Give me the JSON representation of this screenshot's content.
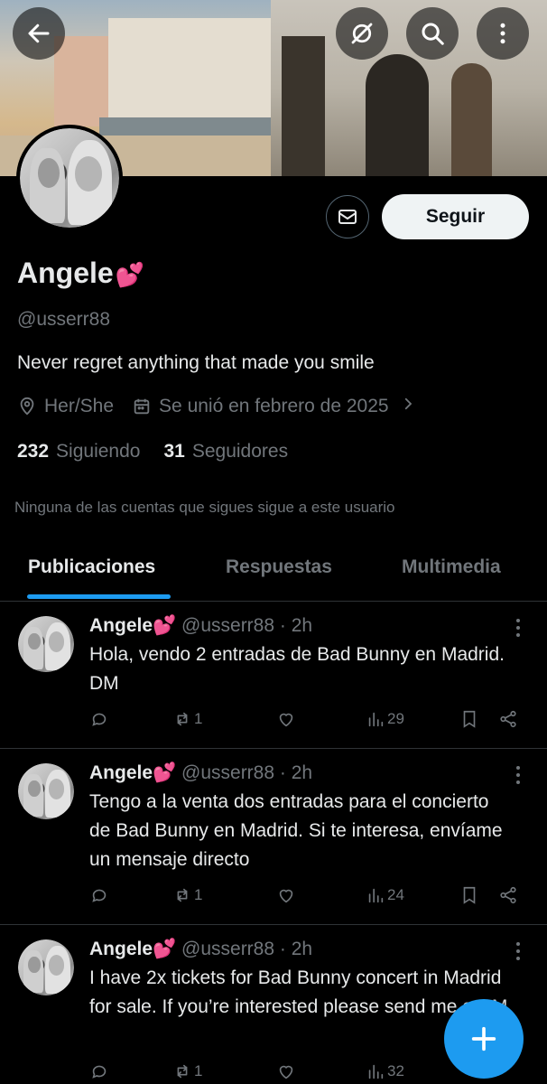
{
  "profile": {
    "name": "Angele",
    "name_emoji": "💕",
    "handle": "@usserr88",
    "bio": "Never regret anything that made you smile",
    "pronouns": "Her/She",
    "joined": "Se unió en febrero de 2025",
    "following_count": "232",
    "following_label": "Siguiendo",
    "followers_count": "31",
    "followers_label": "Seguidores",
    "mutuals_note": "Ninguna de las cuentas que sigues sigue a este usuario"
  },
  "actions": {
    "follow_label": "Seguir"
  },
  "tabs": [
    {
      "label": "Publicaciones",
      "active": true
    },
    {
      "label": "Respuestas",
      "active": false
    },
    {
      "label": "Multimedia",
      "active": false
    }
  ],
  "posts": [
    {
      "name": "Angele",
      "emoji": "💕",
      "handle": "@usserr88",
      "time": "· 2h",
      "text": "Hola, vendo 2 entradas de Bad Bunny en Madrid. DM",
      "reposts": "1",
      "views": "29"
    },
    {
      "name": "Angele",
      "emoji": "💕",
      "handle": "@usserr88",
      "time": "· 2h",
      "text": "Tengo a la venta dos entradas para el concierto de Bad Bunny en Madrid. Si te interesa, envíame un mensaje directo",
      "reposts": "1",
      "views": "24"
    },
    {
      "name": "Angele",
      "emoji": "💕",
      "handle": "@usserr88",
      "time": "· 2h",
      "text": "I have 2x tickets for Bad Bunny concert in Madrid for sale. If you’re interested please send me a DM",
      "reposts": "1",
      "views": "32"
    }
  ],
  "icons": {
    "back": "arrow-left-icon",
    "hide": "eye-slash-icon",
    "search": "search-icon",
    "more": "more-vertical-icon",
    "message": "envelope-icon",
    "location": "location-pin-icon",
    "calendar": "calendar-icon",
    "reply": "reply-icon",
    "repost": "repost-icon",
    "like": "heart-icon",
    "views": "views-icon",
    "bookmark": "bookmark-icon",
    "share": "share-icon",
    "compose": "plus-icon"
  },
  "colors": {
    "accent": "#1d9bf0",
    "background": "#000000",
    "secondary_text": "#71767b",
    "primary_text": "#e7e9ea"
  }
}
